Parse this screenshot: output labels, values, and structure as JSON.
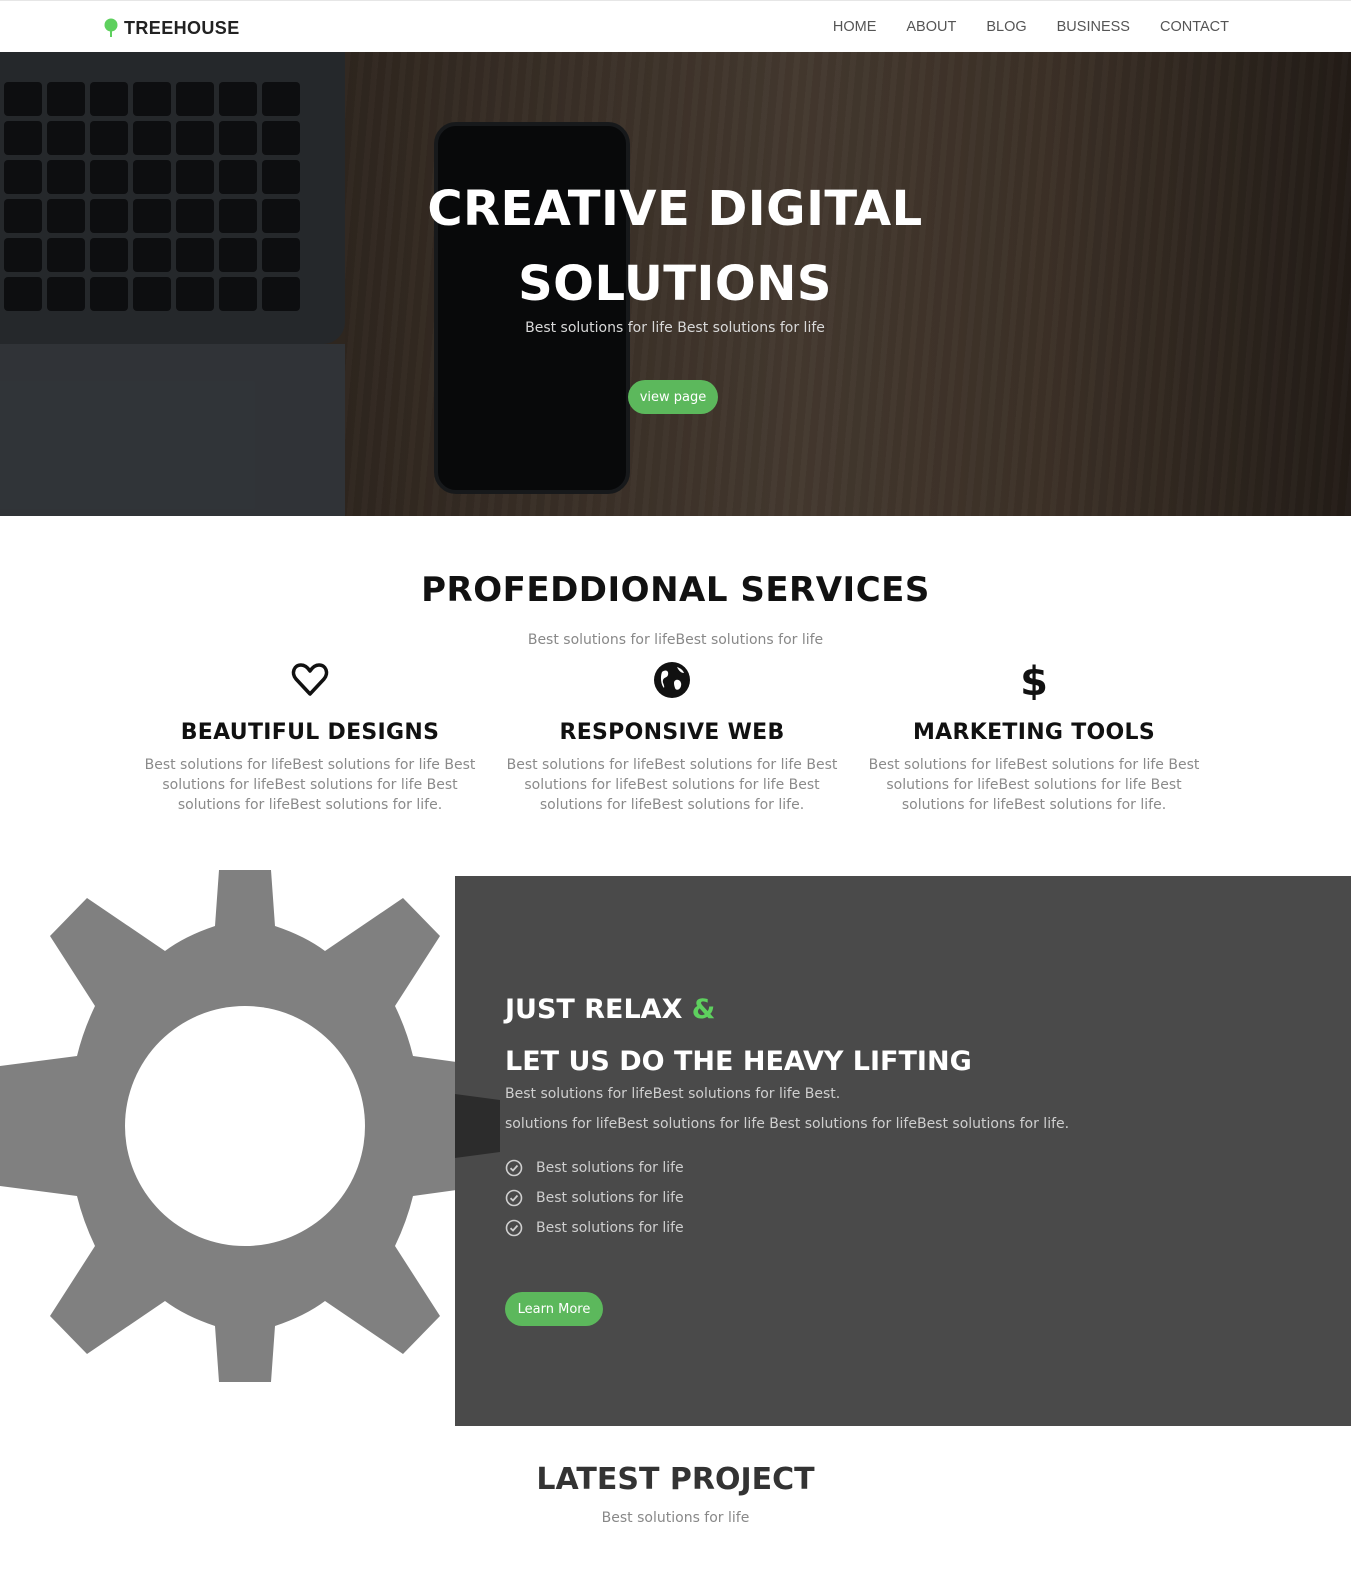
{
  "brand": {
    "name": "TREEHOUSE",
    "icon": "tree-icon",
    "icon_color": "#5ed05e"
  },
  "nav": {
    "items": [
      "HOME",
      "ABOUT",
      "BLOG",
      "BUSINESS",
      "CONTACT"
    ]
  },
  "hero": {
    "title_line1": "CREATIVE DIGITAL",
    "title_line2": "SOLUTIONS",
    "subtitle": "Best solutions for life Best solutions for life",
    "button": "view page"
  },
  "services": {
    "title": "PROFEDDIONAL SERVICES",
    "subtitle": "Best solutions for lifeBest solutions for life",
    "items": [
      {
        "icon": "heart-icon",
        "title": "BEAUTIFUL DESIGNS",
        "text": "Best solutions for lifeBest solutions for life Best solutions for lifeBest solutions for life Best solutions for lifeBest solutions for life."
      },
      {
        "icon": "globe-icon",
        "title": "RESPONSIVE WEB",
        "text": "Best solutions for lifeBest solutions for life Best solutions for lifeBest solutions for life Best solutions for lifeBest solutions for life."
      },
      {
        "icon": "dollar-icon",
        "title": "MARKETING TOOLS",
        "text": "Best solutions for lifeBest solutions for life Best solutions for lifeBest solutions for life Best solutions for lifeBest solutions for life."
      }
    ]
  },
  "relax": {
    "title_part1": "JUST RELAX",
    "title_amp": "&",
    "title_line2": "LET US DO THE HEAVY LIFTING",
    "line1": "Best solutions for lifeBest solutions for life Best.",
    "line2": "solutions for lifeBest solutions for life Best solutions for lifeBest solutions for life.",
    "checks": [
      "Best solutions for life",
      "Best solutions for life",
      "Best solutions for life"
    ],
    "check_icon": "check-circle-icon",
    "button": "Learn More",
    "gear_icon": "gear-icon",
    "panel_color": "#4a4a4a"
  },
  "latest": {
    "title": "LATEST PROJECT",
    "subtitle": "Best solutions for life"
  },
  "colors": {
    "accent": "#5cb85c",
    "text_muted": "#888888"
  }
}
